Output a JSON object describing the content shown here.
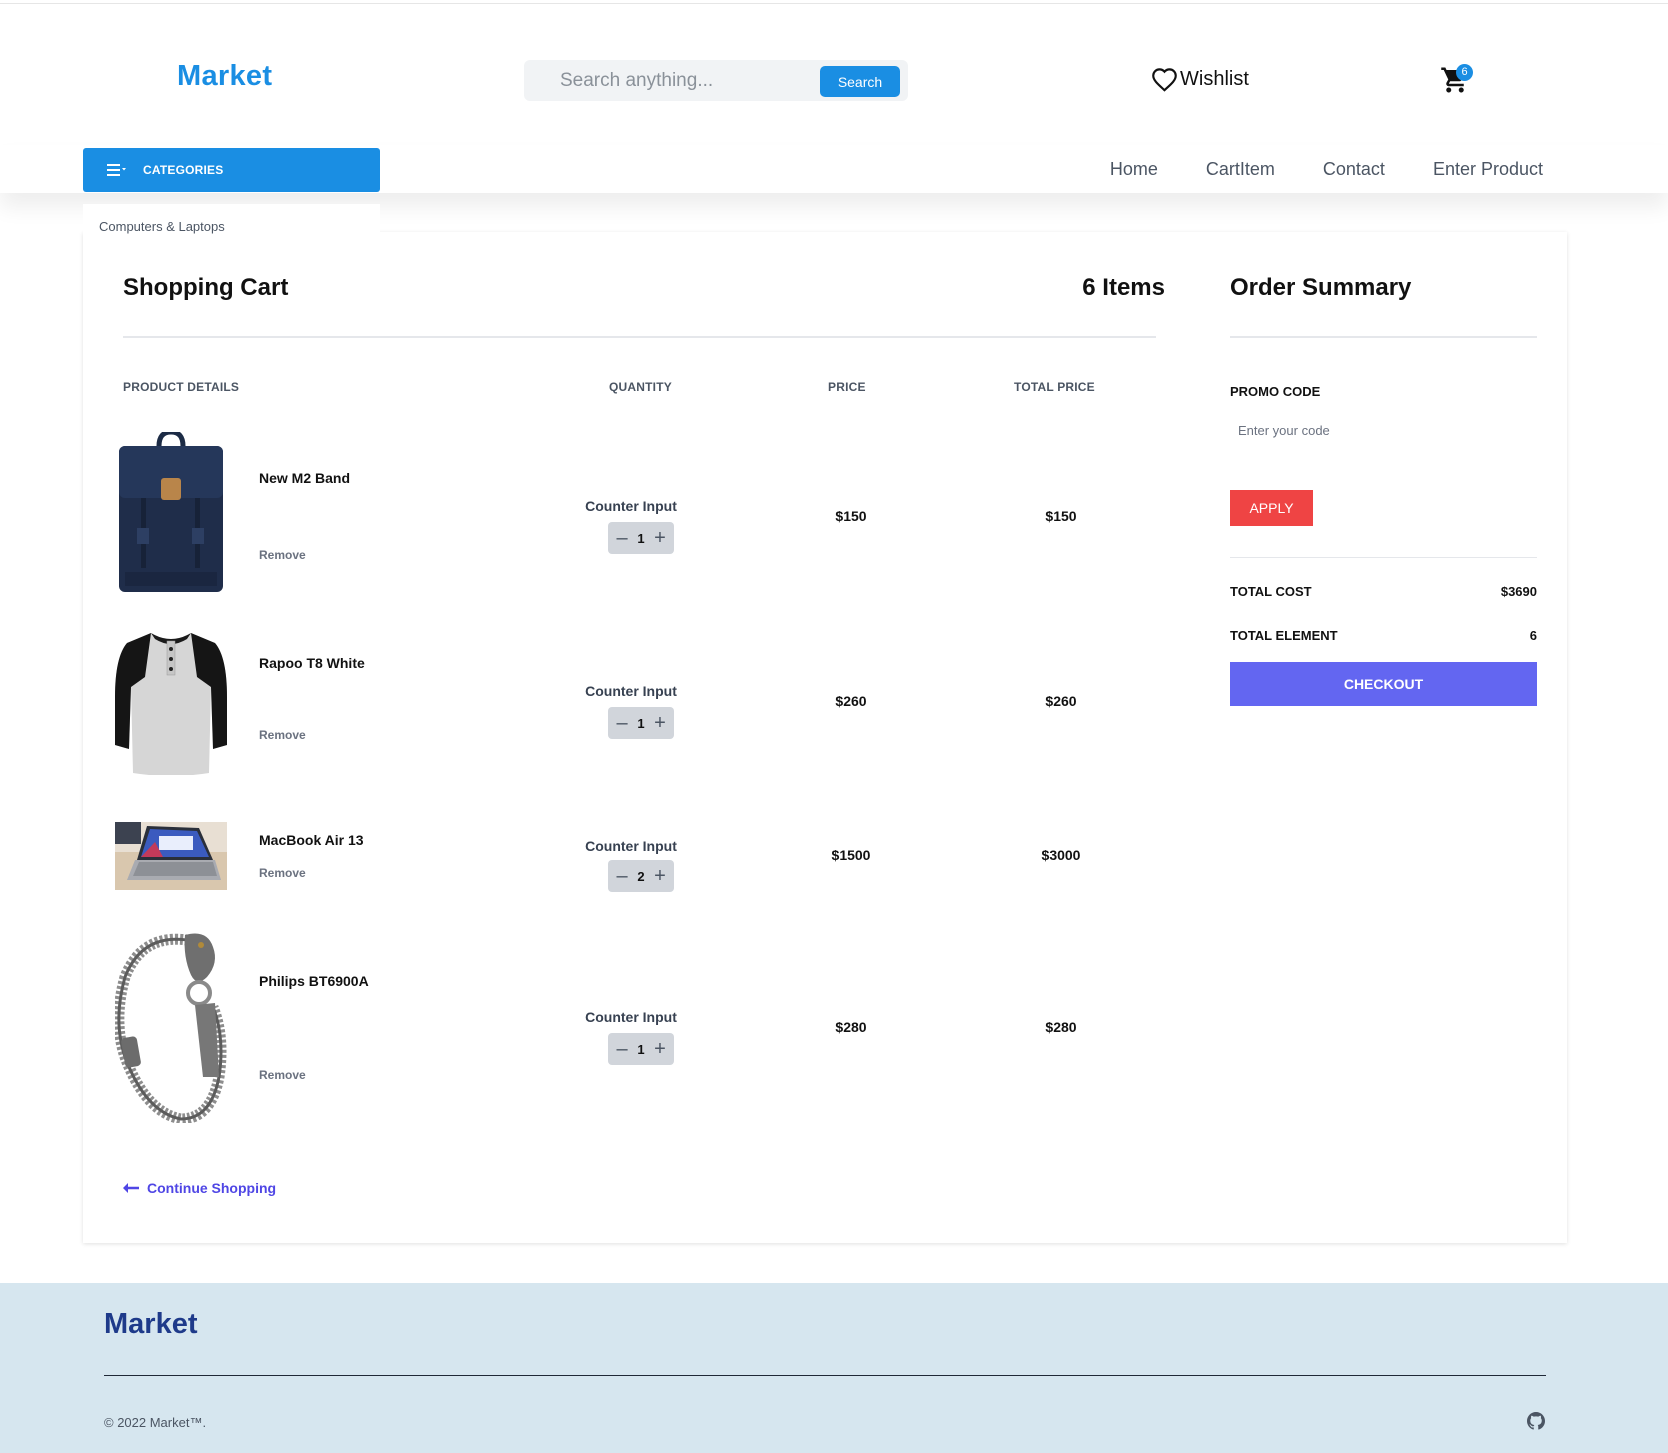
{
  "header": {
    "logo": "Market",
    "search_placeholder": "Search anything...",
    "search_button": "Search",
    "wishlist_label": "Wishlist",
    "cart_badge": "6"
  },
  "navbar": {
    "categories_label": "CATEGORIES",
    "links": [
      "Home",
      "CartItem",
      "Contact",
      "Enter Product"
    ],
    "dropdown_item": "Computers & Laptops"
  },
  "cart": {
    "title": "Shopping Cart",
    "count_label": "6 Items",
    "columns": [
      "PRODUCT DETAILS",
      "QUANTITY",
      "PRICE",
      "TOTAL PRICE"
    ],
    "counter_label": "Counter Input",
    "remove_label": "Remove",
    "items": [
      {
        "name": "New M2 Band",
        "quantity": "1",
        "price": "$150",
        "total": "$150",
        "image": "backpack"
      },
      {
        "name": "Rapoo T8 White",
        "quantity": "1",
        "price": "$260",
        "total": "$260",
        "image": "shirt"
      },
      {
        "name": "MacBook Air 13",
        "quantity": "2",
        "price": "$1500",
        "total": "$3000",
        "image": "laptop"
      },
      {
        "name": "Philips BT6900A",
        "quantity": "1",
        "price": "$280",
        "total": "$280",
        "image": "bracelet"
      }
    ],
    "continue_label": "Continue Shopping"
  },
  "summary": {
    "title": "Order Summary",
    "promo_label": "PROMO CODE",
    "promo_placeholder": "Enter your code",
    "apply_label": "APPLY",
    "total_cost_label": "TOTAL COST",
    "total_cost_value": "$3690",
    "total_element_label": "TOTAL ELEMENT",
    "total_element_value": "6",
    "checkout_label": "CHECKOUT"
  },
  "footer": {
    "logo": "Market",
    "copyright": "© 2022 Market™.",
    "icon": "github-icon"
  },
  "colors": {
    "brand": "#1a8ee3",
    "apply": "#ef4444",
    "checkout": "#6366f1",
    "footer_bg": "#d6e6ef",
    "footer_logo": "#1e3a8a"
  }
}
